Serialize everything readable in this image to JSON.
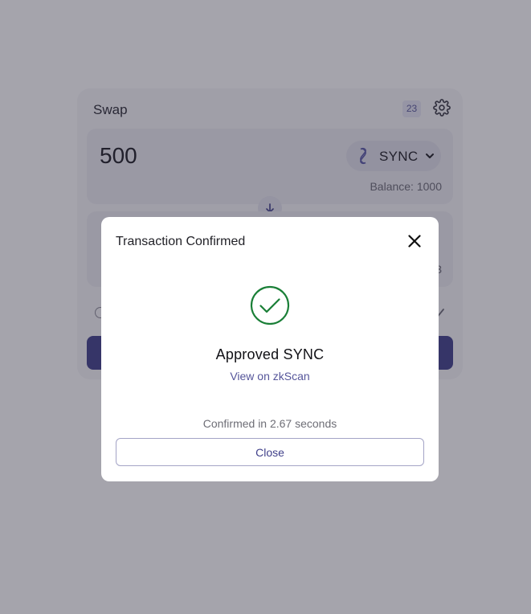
{
  "swap": {
    "title": "Swap",
    "block_badge": "23",
    "from": {
      "amount": "500",
      "token": "SYNC",
      "balance_label": "Balance:",
      "balance_value": "1000"
    },
    "to": {
      "amount_fragment": "",
      "balance_fragment": "3"
    }
  },
  "modal": {
    "title": "Transaction Confirmed",
    "headline": "Approved SYNC",
    "link_text": "View on zkScan",
    "confirm_text": "Confirmed in 2.67 seconds",
    "close_button_label": "Close"
  },
  "icons": {
    "close": "close-icon",
    "success": "check-circle-icon",
    "settings": "gear-icon",
    "token": "sync-token-icon",
    "chevron": "chevron-down-icon",
    "swap_direction": "arrow-down-icon"
  },
  "colors": {
    "accent": "#40408a",
    "success": "#1a7f37",
    "overlay": "#28263a"
  }
}
